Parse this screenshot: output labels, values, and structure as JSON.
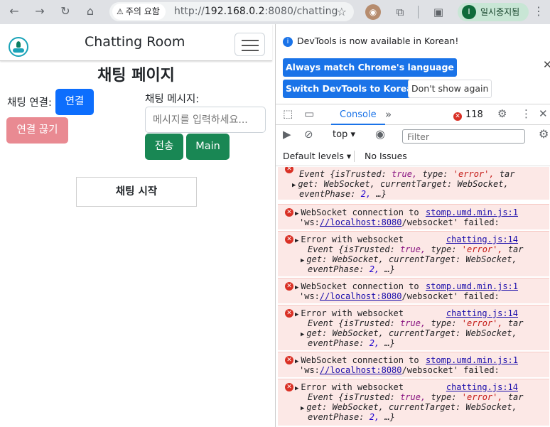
{
  "browser": {
    "security_chip": "주의 요함",
    "url_host": "192.168.0.2",
    "url_rest": ":8080/chatting",
    "url_scheme": "http://",
    "profile_initial": "I",
    "profile_name": "일시중지됨",
    "icons": [
      "back-icon",
      "forward-icon",
      "reload-icon",
      "home-icon",
      "warning-icon",
      "star-icon",
      "extension-icon",
      "puzzle-icon",
      "sidebar-icon",
      "menu-icon"
    ]
  },
  "page": {
    "brand": "Chatting Room",
    "heading": "채팅 페이지",
    "connect_label": "채팅 연결:",
    "connect_button": "연결",
    "disconnect_button": "연결 끊기",
    "message_label": "채팅 메시지:",
    "message_placeholder": "메시지를 입력하세요...",
    "send_button": "전송",
    "main_button": "Main",
    "start_button": "채팅 시작"
  },
  "devtools": {
    "info_text": "DevTools is now available in Korean!",
    "btn_match": "Always match Chrome's language",
    "btn_switch": "Switch DevTools to Korean",
    "btn_dont": "Don't show again",
    "tab_console": "Console",
    "error_count": "118",
    "context": "top",
    "filter_placeholder": "Filter",
    "levels": "Default levels",
    "issues": "No Issues",
    "log": {
      "ws_fail_1": "WebSocket connection to",
      "ws_fail_src": "stomp.umd.min.js:1",
      "ws_fail_2a": "'ws:",
      "ws_fail_2b": "//localhost:8080",
      "ws_fail_2c": "/websocket' failed:",
      "err_title": "Error with websocket",
      "err_src": "chatting.js:14",
      "event_label": "Event",
      "is_trusted_key": "{isTrusted:",
      "is_trusted_val": "true,",
      "type_key": "type:",
      "type_val": "'error',",
      "tar": "tar",
      "get_key": "get:",
      "ws_name": "WebSocket,",
      "ct_key": "currentTarget:",
      "phase_key": "eventPhase:",
      "phase_val": "2,",
      "ellipsis": "…}"
    }
  }
}
